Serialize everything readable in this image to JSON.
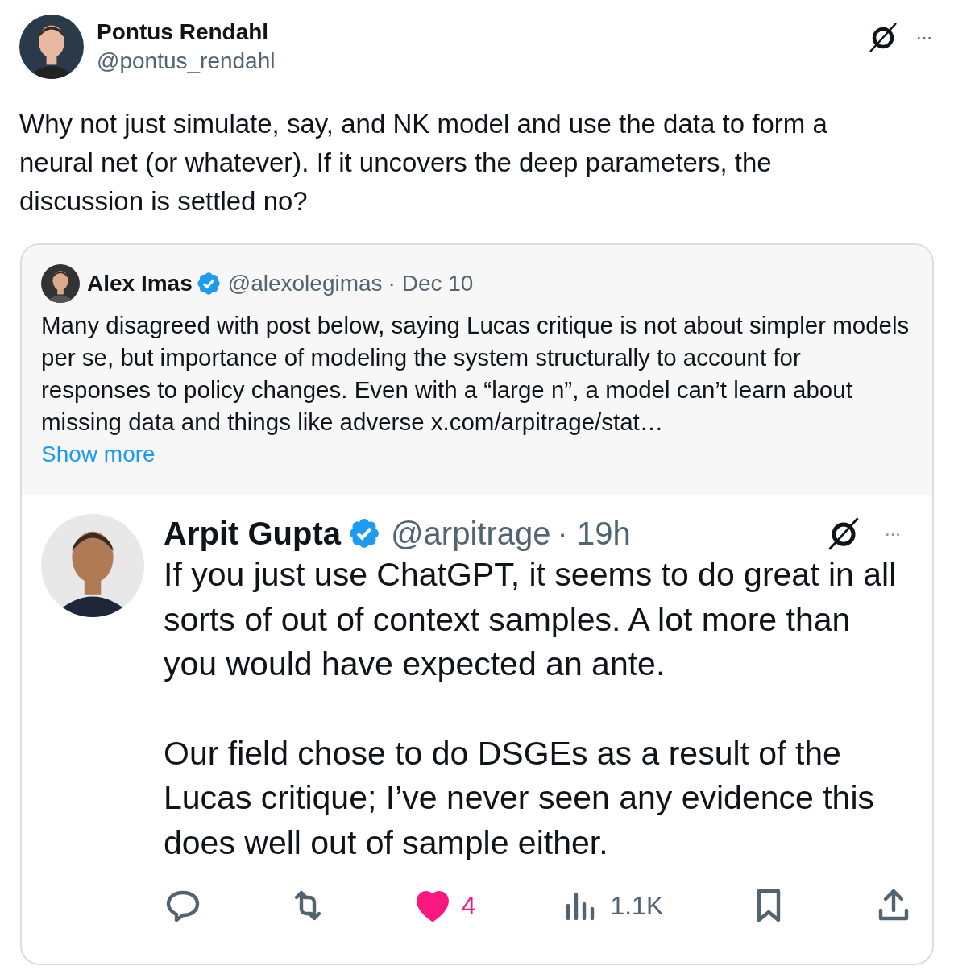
{
  "post": {
    "author": "Pontus Rendahl",
    "handle": "@pontus_rendahl",
    "more": "···",
    "text": "Why not just simulate, say, and NK model and use the data to form a neural net (or whatever). If it uncovers the deep parameters, the discussion is settled no?"
  },
  "quote": {
    "author": "Alex Imas",
    "verified": true,
    "handle": "@alexolegimas",
    "time": "· Dec 10",
    "text": "Many disagreed with post below, saying Lucas critique is not about simpler models per se, but importance of modeling the system structurally to account for responses to policy changes. Even with a “large n”, a model can’t learn about missing data and things like adverse  x.com/arpitrage/stat…",
    "show_more": "Show more"
  },
  "embedded": {
    "author": "Arpit Gupta",
    "verified": true,
    "handle": "@arpitrage",
    "time": "· 19h",
    "more": "···",
    "paragraphs": [
      "If you just use ChatGPT, it seems to do great in all sorts of out of context samples. A lot more than you would have expected an ante.",
      "Our field chose to do DSGEs as a result of the Lucas critique; I’ve never seen any evidence this does well out of sample either."
    ],
    "actions": [
      {
        "kind": "reply"
      },
      {
        "kind": "repost"
      },
      {
        "kind": "like",
        "liked": true,
        "count": "4"
      },
      {
        "kind": "views",
        "count": "1.1K"
      },
      {
        "kind": "bookmark"
      },
      {
        "kind": "share"
      }
    ]
  }
}
